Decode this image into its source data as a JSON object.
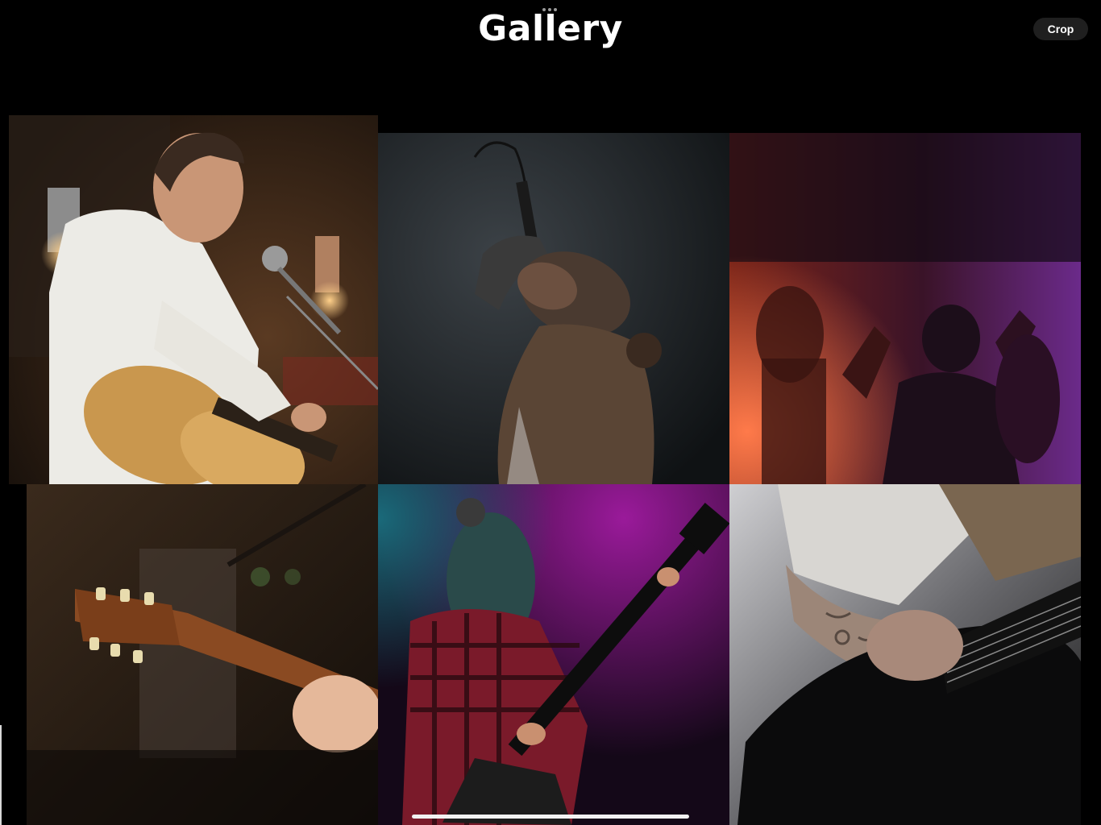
{
  "header": {
    "title": "Gallery",
    "crop_label": "Crop"
  },
  "gallery": {
    "photos": [
      {
        "icon": "photo-acoustic-guitar-singer"
      },
      {
        "icon": "photo-singer-microphone-smoke"
      },
      {
        "icon": "photo-concert-crowd-silhouettes"
      },
      {
        "icon": "photo-guitar-headstock-closeup"
      },
      {
        "icon": "photo-guitarist-magenta-light"
      },
      {
        "icon": "photo-electric-guitar-closeup"
      }
    ]
  },
  "colors": {
    "background": "#000000",
    "button_bg": "#1f1f1f",
    "text": "#ffffff"
  }
}
